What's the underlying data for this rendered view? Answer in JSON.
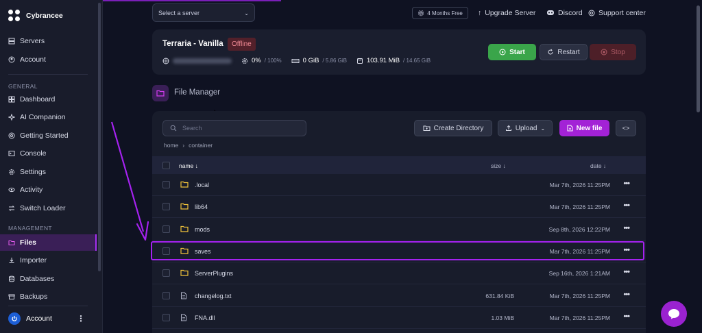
{
  "brand": {
    "name": "Cybrancee"
  },
  "sidebar": {
    "top_items": [
      {
        "label": "Servers",
        "icon": "servers-icon"
      },
      {
        "label": "Account",
        "icon": "account-icon"
      }
    ],
    "section_general": "GENERAL",
    "general_items": [
      {
        "label": "Dashboard",
        "icon": "dashboard-icon"
      },
      {
        "label": "AI Companion",
        "icon": "ai-companion-icon"
      },
      {
        "label": "Getting Started",
        "icon": "getting-started-icon"
      },
      {
        "label": "Console",
        "icon": "console-icon"
      },
      {
        "label": "Settings",
        "icon": "settings-icon"
      },
      {
        "label": "Activity",
        "icon": "activity-icon"
      },
      {
        "label": "Switch Loader",
        "icon": "switch-loader-icon"
      }
    ],
    "section_management": "MANAGEMENT",
    "management_items": [
      {
        "label": "Files",
        "icon": "files-icon",
        "active": true
      },
      {
        "label": "Importer",
        "icon": "importer-icon"
      },
      {
        "label": "Databases",
        "icon": "databases-icon"
      },
      {
        "label": "Backups",
        "icon": "backups-icon"
      }
    ],
    "account_label": "Account"
  },
  "topbar": {
    "server_select_placeholder": "Select a server",
    "months_badge": "4 Months Free",
    "upgrade": "Upgrade Server",
    "discord": "Discord",
    "support": "Support center"
  },
  "server": {
    "name": "Terraria - Vanilla",
    "status": "Offline",
    "cpu": "0%",
    "cpu_max": "/ 100%",
    "memory": "0 GiB",
    "memory_max": "/ 5.86 GiB",
    "disk": "103.91 MiB",
    "disk_max": "/ 14.65 GiB",
    "start": "Start",
    "restart": "Restart",
    "stop": "Stop"
  },
  "file_manager": {
    "title": "File Manager",
    "search_placeholder": "Search",
    "breadcrumb": [
      "home",
      "container"
    ],
    "create_directory": "Create Directory",
    "upload": "Upload",
    "new_file": "New file",
    "code_toggle": "<>",
    "columns": {
      "name": "name ↓",
      "size": "size ↓",
      "date": "date ↓"
    },
    "files": [
      {
        "name": ".local",
        "type": "folder",
        "size": "",
        "date": "Mar 7th, 2026 11:25PM"
      },
      {
        "name": "lib64",
        "type": "folder",
        "size": "",
        "date": "Mar 7th, 2026 11:25PM"
      },
      {
        "name": "mods",
        "type": "folder",
        "size": "",
        "date": "Sep 8th, 2026 12:22PM"
      },
      {
        "name": "saves",
        "type": "folder",
        "size": "",
        "date": "Mar 7th, 2026 11:25PM"
      },
      {
        "name": "ServerPlugins",
        "type": "folder",
        "size": "",
        "date": "Sep 16th, 2026 1:21AM"
      },
      {
        "name": "changelog.txt",
        "type": "file",
        "size": "631.84 KiB",
        "date": "Mar 7th, 2026 11:25PM"
      },
      {
        "name": "FNA.dll",
        "type": "file",
        "size": "1.03 MiB",
        "date": "Mar 7th, 2026 11:25PM"
      }
    ]
  },
  "colors": {
    "accent": "#a322d6",
    "start": "#3aa54a",
    "offline": "#52202a",
    "folder": "#f0c23a"
  }
}
